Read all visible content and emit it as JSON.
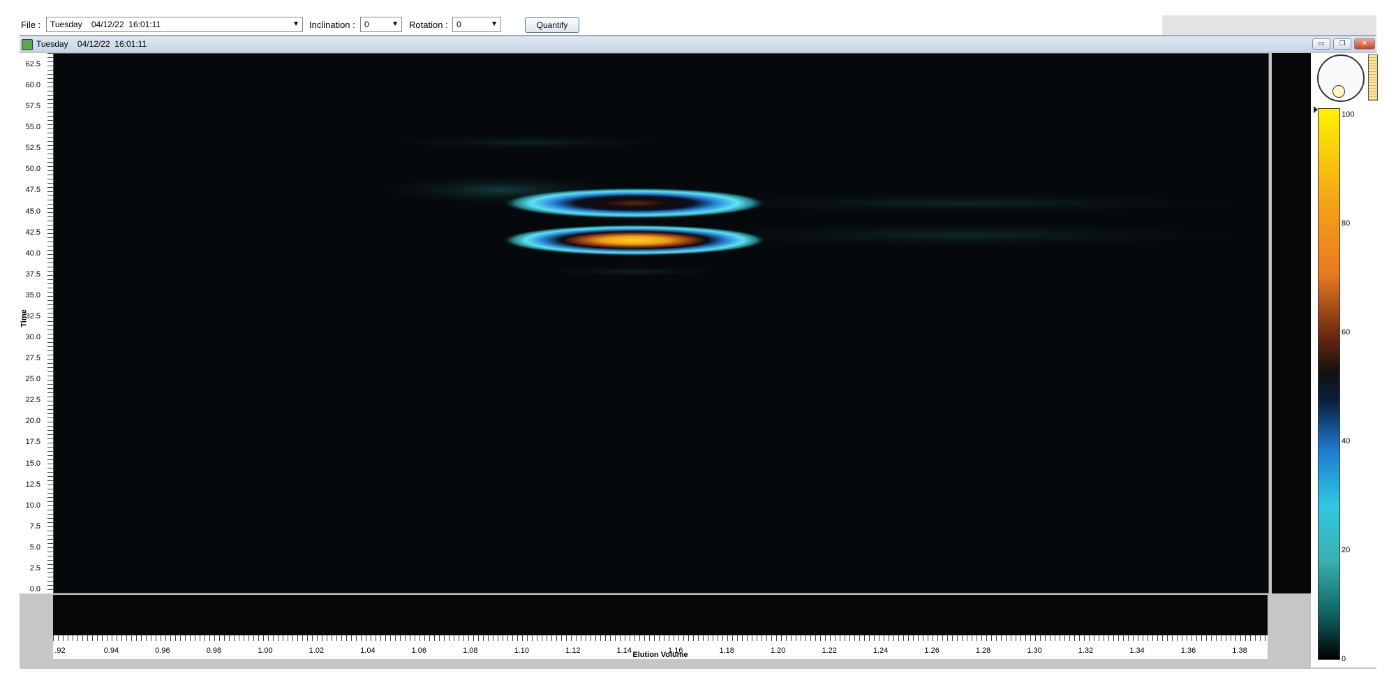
{
  "toolbar": {
    "file_label": "File :",
    "file_value": "Tuesday    04/12/22  16:01:11",
    "inclination_label": "Inclination :",
    "inclination_value": "0",
    "rotation_label": "Rotation :",
    "rotation_value": "0",
    "quantify_label": "Quantify"
  },
  "window": {
    "title": "Tuesday    04/12/22  16:01:11",
    "icon": "app-icon",
    "controls": [
      "minimize-icon",
      "restore-icon",
      "close-icon"
    ]
  },
  "plot": {
    "ylabel": "Time",
    "xlabel": "Elution Volume",
    "y_ticks": [
      "62.5",
      "60.0",
      "57.5",
      "55.0",
      "52.5",
      "50.0",
      "47.5",
      "45.0",
      "42.5",
      "40.0",
      "37.5",
      "35.0",
      "32.5",
      "30.0",
      "27.5",
      "25.0",
      "22.5",
      "20.0",
      "17.5",
      "15.0",
      "12.5",
      "10.0",
      "7.5",
      "5.0",
      "2.5",
      "0.0"
    ],
    "x_ticks": [
      ".92",
      "0.94",
      "0.96",
      "0.98",
      "1.00",
      "1.02",
      "1.04",
      "1.06",
      "1.08",
      "1.10",
      "1.12",
      "1.14",
      "1.16",
      "1.18",
      "1.20",
      "1.22",
      "1.24",
      "1.26",
      "1.28",
      "1.30",
      "1.32",
      "1.34",
      "1.36",
      "1.38"
    ],
    "colorbar_ticks": [
      "100",
      "80",
      "60",
      "40",
      "20",
      "0"
    ],
    "colors": {
      "peak_high": "#f4a316",
      "peak_ring": "#2ec8e4",
      "background": "#06090b"
    }
  }
}
